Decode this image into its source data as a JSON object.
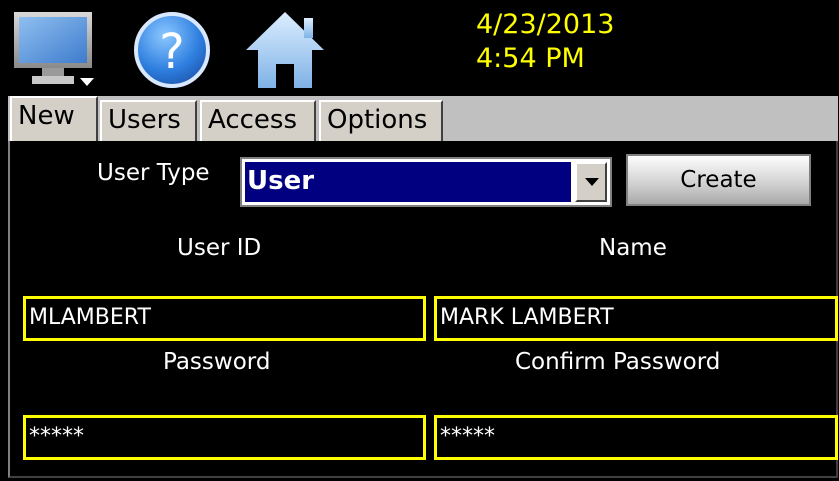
{
  "header": {
    "date": "4/23/2013",
    "time": "4:54 PM",
    "icons": [
      "monitor-menu-icon",
      "help-icon",
      "home-icon"
    ]
  },
  "tabs": [
    {
      "label": "New",
      "active": true
    },
    {
      "label": "Users",
      "active": false
    },
    {
      "label": "Access",
      "active": false
    },
    {
      "label": "Options",
      "active": false
    }
  ],
  "form": {
    "user_type_label": "User Type",
    "user_type_value": "User",
    "create_label": "Create",
    "user_id_label": "User ID",
    "name_label": "Name",
    "user_id_value": "MLAMBERT",
    "name_value": "MARK LAMBERT",
    "password_label": "Password",
    "confirm_password_label": "Confirm Password",
    "password_value": "*****",
    "confirm_password_value": "*****"
  },
  "colors": {
    "background": "#000000",
    "clock_text": "#ffff00",
    "field_border": "#ffff00",
    "select_highlight": "#000080",
    "tab_face": "#d4d0c8"
  }
}
